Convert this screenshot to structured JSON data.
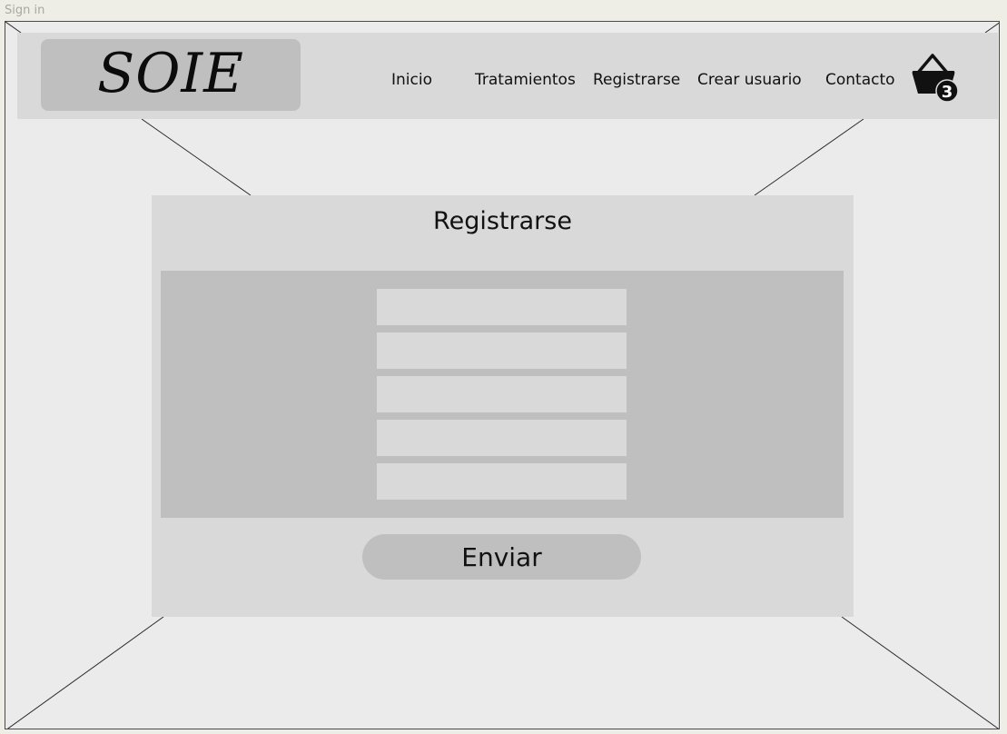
{
  "frame": {
    "label": "Sign in"
  },
  "header": {
    "logo": "SOIE",
    "nav": [
      "Inicio",
      "Tratamientos",
      "Registrarse",
      "Crear usuario",
      "Contacto"
    ],
    "cart_count": "3"
  },
  "register": {
    "title": "Registrarse",
    "fields": [
      "",
      "",
      "",
      "",
      ""
    ],
    "submit_label": "Enviar"
  },
  "colors": {
    "page_bg": "#ebebeb",
    "header_bg": "#d9d9d9",
    "panel_bg": "#bfbfbf",
    "text": "#111111"
  },
  "icons": {
    "cart": "shopping-basket-icon"
  }
}
